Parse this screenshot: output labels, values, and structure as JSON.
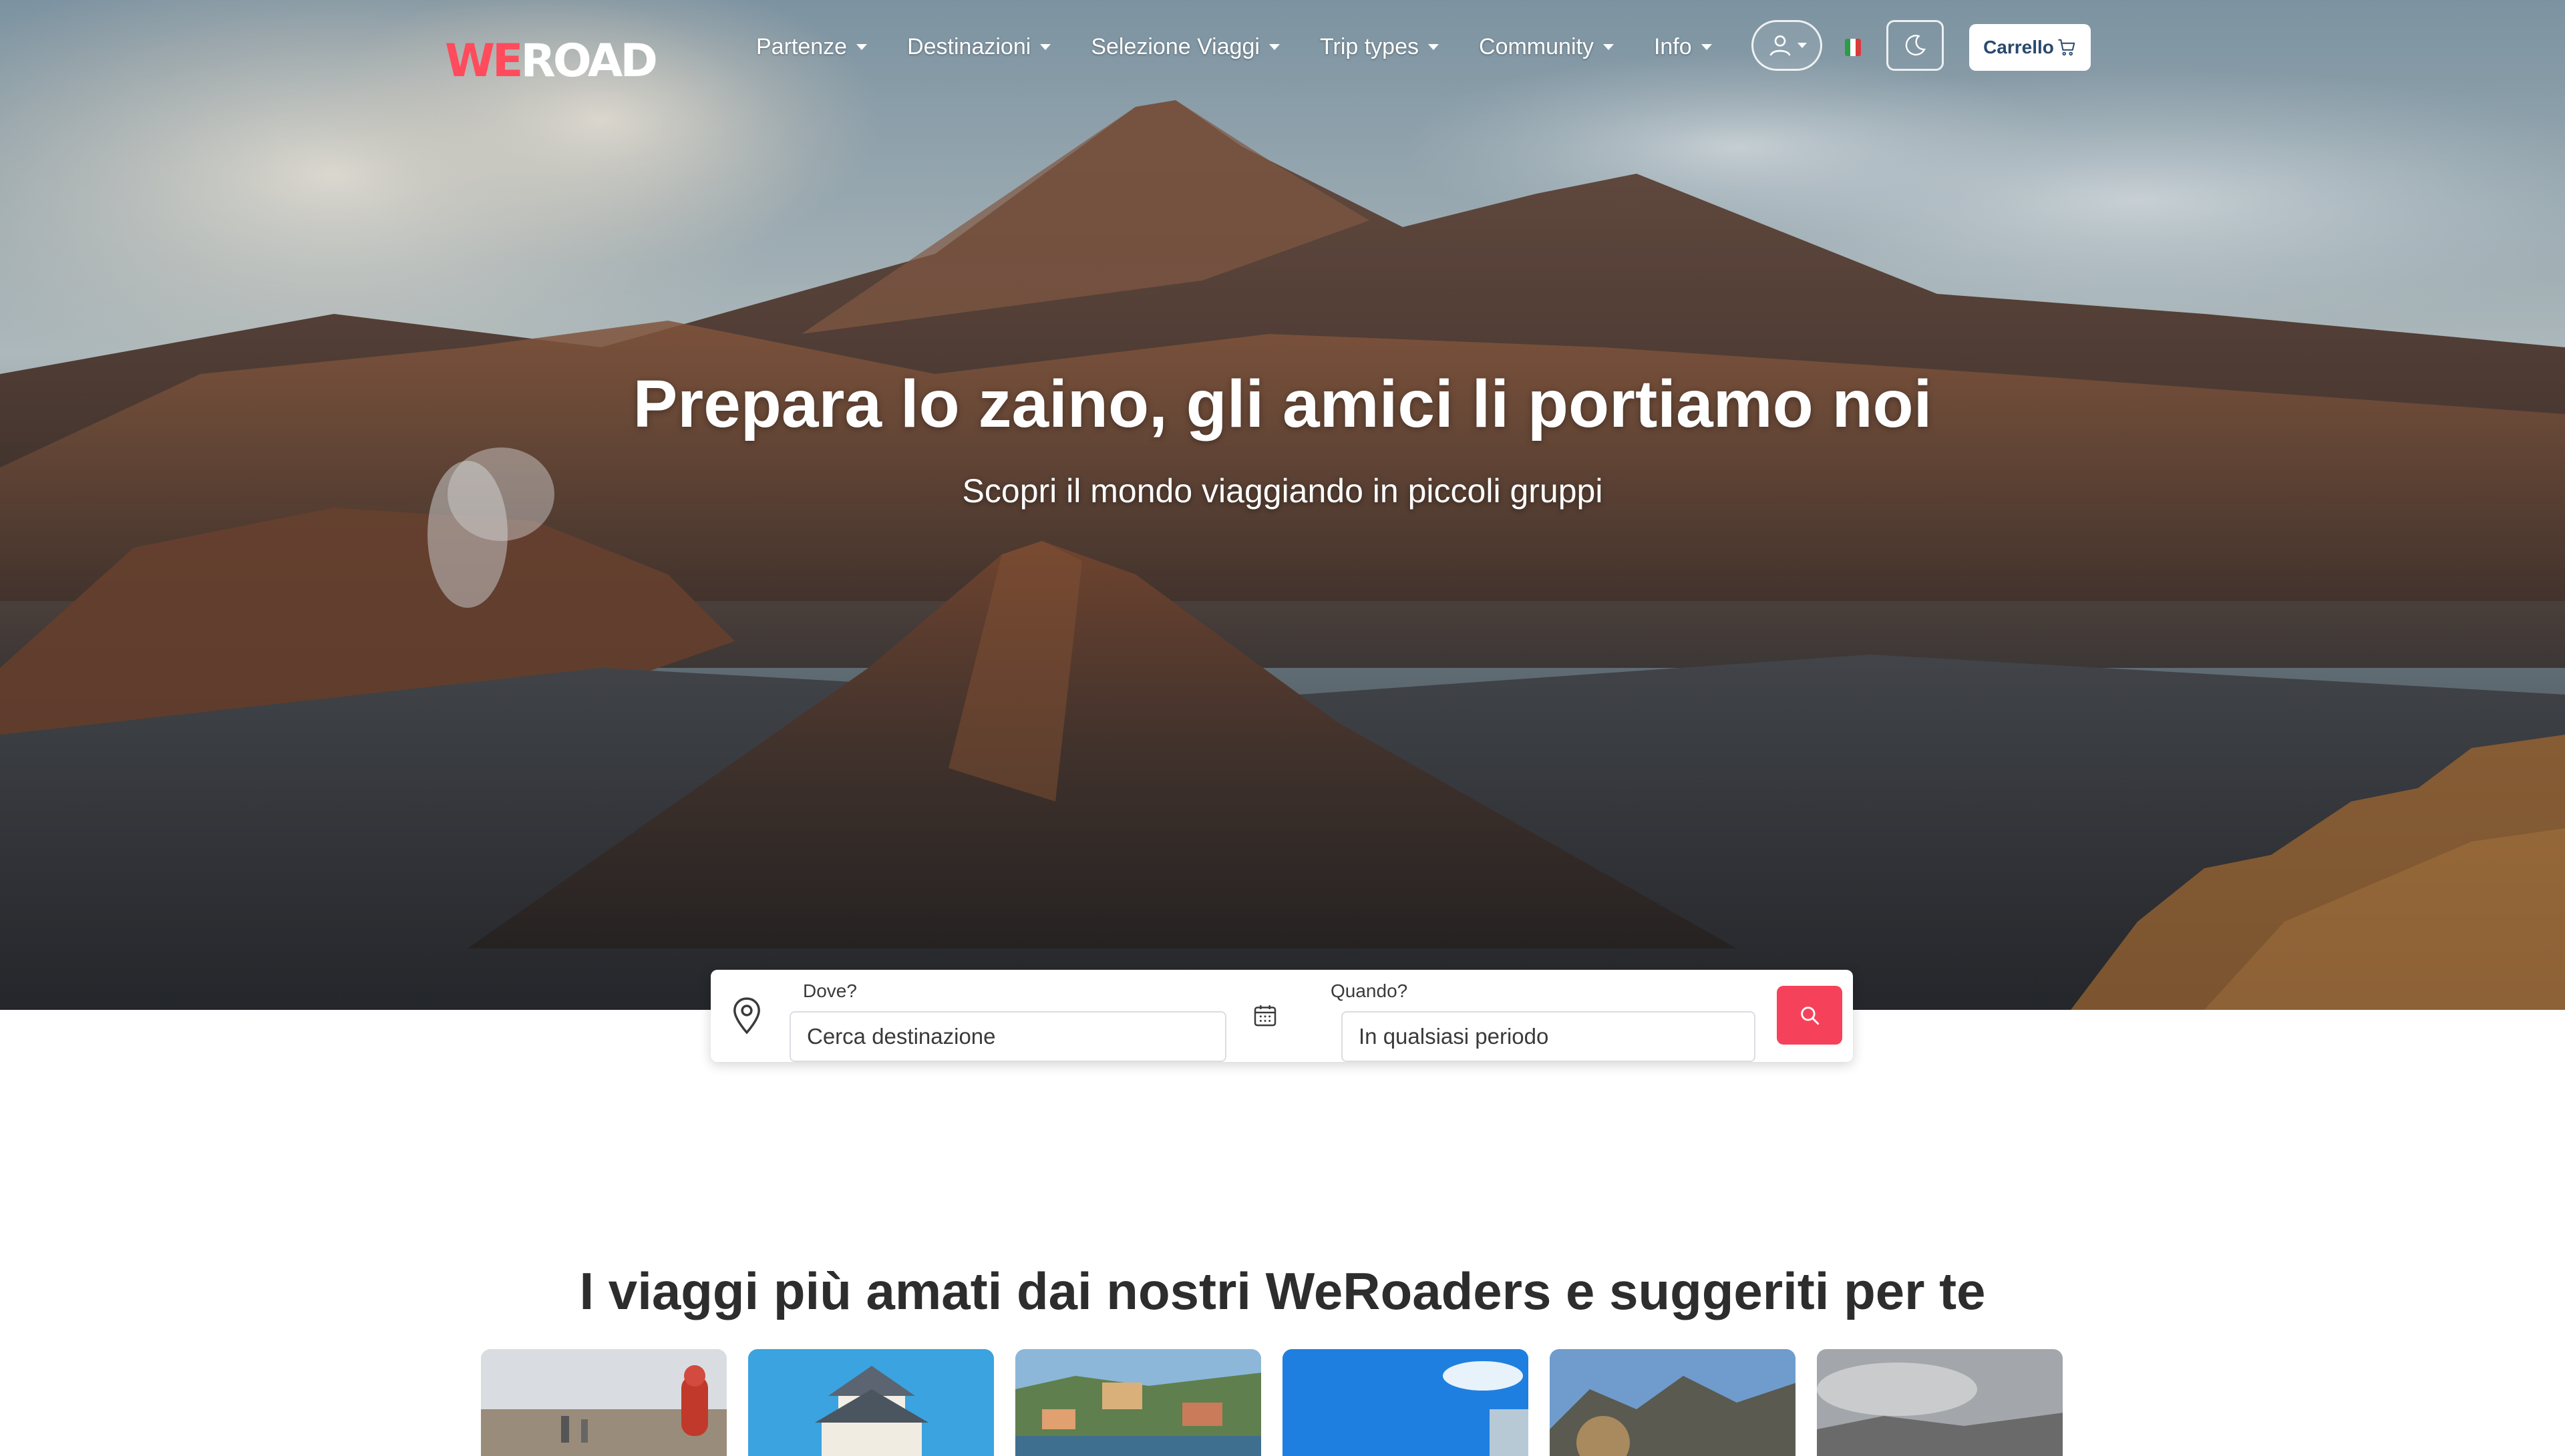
{
  "brand": {
    "logo_we": "WE",
    "logo_road": "ROAD",
    "accent_color": "#ff4b5c"
  },
  "nav": {
    "items": [
      {
        "label": "Partenze",
        "icon": "chevron-down-icon"
      },
      {
        "label": "Destinazioni",
        "icon": "chevron-down-icon"
      },
      {
        "label": "Selezione Viaggi",
        "icon": "chevron-down-icon"
      },
      {
        "label": "Trip types",
        "icon": "chevron-down-icon"
      },
      {
        "label": "Community",
        "icon": "chevron-down-icon"
      },
      {
        "label": "Info",
        "icon": "chevron-down-icon"
      }
    ],
    "user_icon": "user-icon",
    "language_flag": "italian-flag-icon",
    "theme_icon": "moon-icon",
    "cart_label": "Carrello",
    "cart_icon": "cart-icon"
  },
  "hero": {
    "title": "Prepara lo zaino, gli amici li portiamo noi",
    "subtitle": "Scopri il mondo viaggiando in piccoli gruppi"
  },
  "search": {
    "where_label": "Dove?",
    "where_placeholder": "Cerca destinazione",
    "where_icon": "map-pin-icon",
    "when_label": "Quando?",
    "when_value": "In qualsiasi periodo",
    "when_icon": "calendar-icon",
    "button_icon": "search-icon",
    "button_color": "#f5425a"
  },
  "trips_section": {
    "title": "I viaggi più amati dai nostri WeRoaders e suggeriti per te",
    "cards": [
      {
        "image": "trekking-group-photo"
      },
      {
        "image": "japanese-castle-photo"
      },
      {
        "image": "coastal-village-photo"
      },
      {
        "image": "blue-sky-coast-photo"
      },
      {
        "image": "mountain-lake-photo"
      },
      {
        "image": "cloudy-landscape-photo"
      }
    ]
  }
}
